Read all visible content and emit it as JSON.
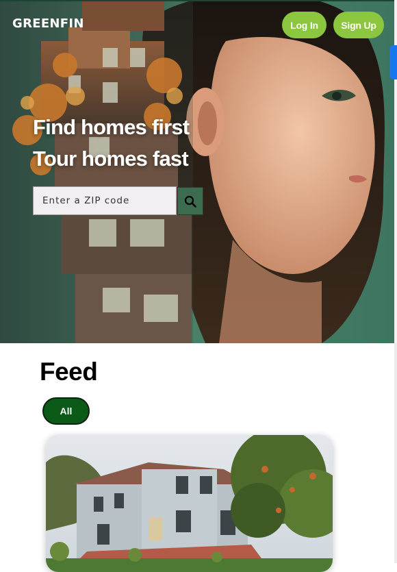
{
  "brand": {
    "logo_text": "GREENFIN",
    "accent": "#8cc63f",
    "dark_green": "#0b5a17"
  },
  "header": {
    "login_label": "Log In",
    "signup_label": "Sign Up"
  },
  "hero": {
    "headline_1": "Find homes first",
    "headline_2": "Tour homes fast",
    "search": {
      "placeholder": "Enter a ZIP code",
      "value": "",
      "button_icon": "search-icon"
    }
  },
  "feed": {
    "title": "Feed",
    "filters": [
      {
        "label": "All",
        "selected": true
      }
    ]
  }
}
